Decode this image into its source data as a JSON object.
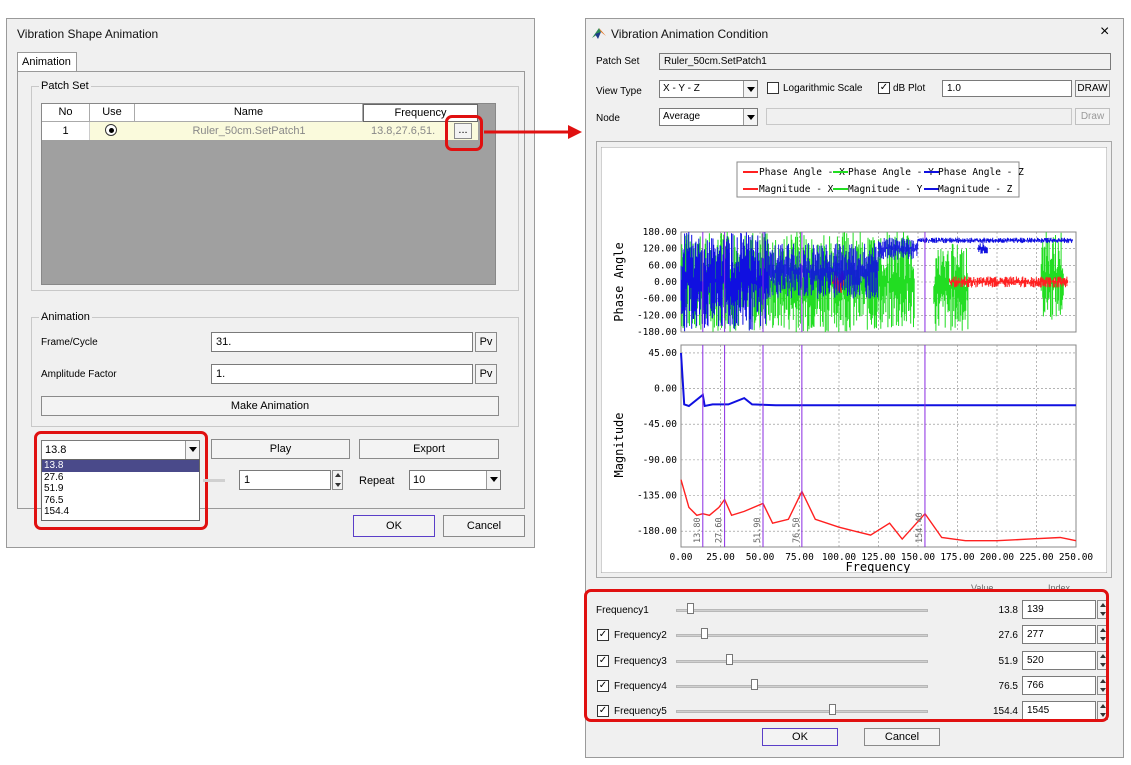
{
  "left_dialog": {
    "title": "Vibration Shape Animation",
    "tab": "Animation",
    "patch_group": "Patch Set",
    "table": {
      "headers": [
        "No",
        "Use",
        "Name",
        "Frequency"
      ],
      "rows": [
        {
          "no": "1",
          "name": "Ruler_50cm.SetPatch1",
          "frequency": "13.8,27.6,51.9..."
        }
      ],
      "browse": "..."
    },
    "anim_group": "Animation",
    "frame_label": "Frame/Cycle",
    "frame_value": "31.",
    "amp_label": "Amplitude Factor",
    "amp_value": "1.",
    "pv": "Pv",
    "make_btn": "Make Animation",
    "freq_select": "13.8",
    "freq_options": [
      "13.8",
      "27.6",
      "51.9",
      "76.5",
      "154.4"
    ],
    "play": "Play",
    "export": "Export",
    "step_value": "1",
    "repeat_label": "Repeat",
    "repeat_value": "10",
    "ok": "OK",
    "cancel": "Cancel"
  },
  "right_dialog": {
    "title": "Vibration Animation Condition",
    "close": "×",
    "patch_label": "Patch Set",
    "patch_value": "Ruler_50cm.SetPatch1",
    "view_label": "View Type",
    "view_value": "X - Y - Z",
    "log_label": "Logarithmic Scale",
    "db_label": "dB Plot",
    "db_value": "1.0",
    "draw_upper": "DRAW",
    "node_label": "Node",
    "node_value": "Average",
    "draw": "Draw",
    "value_head": "Value",
    "index_head": "Index",
    "frequencies": [
      {
        "label": "Frequency1",
        "value": "13.8",
        "index": "139",
        "checkbox": false,
        "position": 0.055
      },
      {
        "label": "Frequency2",
        "value": "27.6",
        "index": "277",
        "checkbox": true,
        "position": 0.11
      },
      {
        "label": "Frequency3",
        "value": "51.9",
        "index": "520",
        "checkbox": true,
        "position": 0.21
      },
      {
        "label": "Frequency4",
        "value": "76.5",
        "index": "766",
        "checkbox": true,
        "position": 0.31
      },
      {
        "label": "Frequency5",
        "value": "154.4",
        "index": "1545",
        "checkbox": true,
        "position": 0.62
      }
    ],
    "ok": "OK",
    "cancel": "Cancel"
  },
  "chart_data": {
    "type": "line",
    "xlabel": "Frequency",
    "xlim": [
      0,
      250
    ],
    "xticks": [
      "0.00",
      "25.00",
      "50.00",
      "75.00",
      "100.00",
      "125.00",
      "150.00",
      "175.00",
      "200.00",
      "225.00",
      "250.00"
    ],
    "legend": [
      "Phase Angle - X",
      "Phase Angle - Y",
      "Phase Angle - Z",
      "Magnitude - X",
      "Magnitude - Y",
      "Magnitude - Z"
    ],
    "colors": {
      "x": "#ff2020",
      "y": "#22dd22",
      "z": "#1010e0",
      "marker": "#8a2be2"
    },
    "markers": [
      13.8,
      27.6,
      51.9,
      76.5,
      154.4
    ],
    "marker_labels": [
      "13.80",
      "27.60",
      "51.90",
      "76.50",
      "154.40"
    ],
    "phase": {
      "ylabel": "Phase Angle",
      "ylim": [
        -180,
        180
      ],
      "yticks": [
        "180.00",
        "120.00",
        "60.00",
        "0.00",
        "-60.00",
        "-120.00",
        "-180.00"
      ]
    },
    "magnitude": {
      "ylabel": "Magnitude",
      "ylim": [
        -200,
        55
      ],
      "yticks": [
        "45.00",
        "0.00",
        "-45.00",
        "-90.00",
        "-135.00",
        "-180.00"
      ],
      "series_x": {
        "x": [
          0,
          5,
          10,
          13.8,
          18,
          24,
          27.6,
          32,
          40,
          51.9,
          58,
          68,
          76.5,
          85,
          100,
          110,
          120,
          132,
          140,
          154.4,
          165,
          180,
          200,
          220,
          240,
          250
        ],
        "y": [
          -115,
          -150,
          -160,
          -158,
          -160,
          -150,
          -140,
          -160,
          -155,
          -145,
          -170,
          -165,
          -130,
          -165,
          -175,
          -180,
          -185,
          -170,
          -190,
          -158,
          -188,
          -192,
          -192,
          -190,
          -188,
          -192
        ]
      },
      "series_z": {
        "x": [
          0,
          2,
          5,
          13.8,
          15,
          20,
          30,
          40,
          45,
          60,
          100,
          150,
          200,
          250
        ],
        "y": [
          45,
          -20,
          -22,
          -8,
          -22,
          -20,
          -20,
          -12,
          -20,
          -21,
          -21,
          -21,
          -21,
          -21
        ]
      }
    }
  }
}
